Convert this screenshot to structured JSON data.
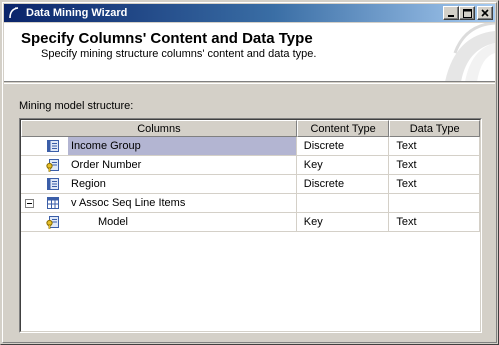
{
  "window": {
    "title": "Data Mining Wizard",
    "minimize": "_",
    "maximize": "□",
    "close": "✕"
  },
  "header": {
    "title": "Specify Columns' Content and Data Type",
    "subtitle": "Specify mining structure columns' content and data type."
  },
  "section": {
    "label": "Mining model structure:"
  },
  "grid": {
    "headers": [
      "Columns",
      "Content Type",
      "Data Type"
    ],
    "rows": [
      {
        "name": "Income Group",
        "content_type": "Discrete",
        "data_type": "Text",
        "icon": "column-icon",
        "selected": true
      },
      {
        "name": "Order Number",
        "content_type": "Key",
        "data_type": "Text",
        "icon": "key-column-icon",
        "selected": false
      },
      {
        "name": "Region",
        "content_type": "Discrete",
        "data_type": "Text",
        "icon": "column-icon",
        "selected": false
      },
      {
        "name": "v Assoc Seq Line Items",
        "content_type": "",
        "data_type": "",
        "icon": "nested-table-icon",
        "expander": "collapse",
        "selected": false
      },
      {
        "name": "Model",
        "content_type": "Key",
        "data_type": "Text",
        "icon": "key-column-icon",
        "selected": false
      }
    ]
  },
  "colors": {
    "title_bar_start": "#0a246a",
    "title_bar_end": "#a6caf0",
    "selection": "#b3b5d2",
    "face": "#d4d0c8"
  }
}
